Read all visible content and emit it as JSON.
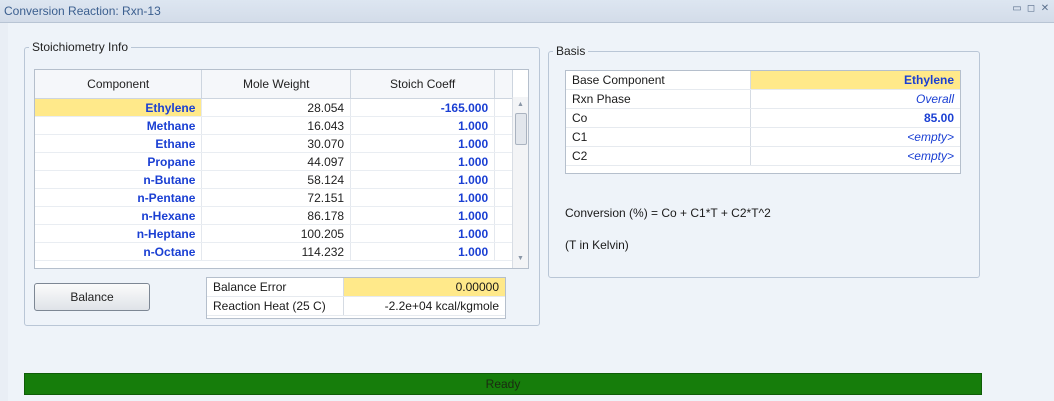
{
  "window": {
    "title": "Conversion Reaction: Rxn-13"
  },
  "stoich": {
    "legend": "Stoichiometry Info",
    "headers": [
      "Component",
      "Mole Weight",
      "Stoich Coeff"
    ],
    "rows": [
      {
        "component": "Ethylene",
        "mw": "28.054",
        "coeff": "-165.000"
      },
      {
        "component": "Methane",
        "mw": "16.043",
        "coeff": "1.000"
      },
      {
        "component": "Ethane",
        "mw": "30.070",
        "coeff": "1.000"
      },
      {
        "component": "Propane",
        "mw": "44.097",
        "coeff": "1.000"
      },
      {
        "component": "n-Butane",
        "mw": "58.124",
        "coeff": "1.000"
      },
      {
        "component": "n-Pentane",
        "mw": "72.151",
        "coeff": "1.000"
      },
      {
        "component": "n-Hexane",
        "mw": "86.178",
        "coeff": "1.000"
      },
      {
        "component": "n-Heptane",
        "mw": "100.205",
        "coeff": "1.000"
      },
      {
        "component": "n-Octane",
        "mw": "114.232",
        "coeff": "1.000"
      }
    ],
    "balance_button": "Balance",
    "balance_error_label": "Balance Error",
    "balance_error_value": "0.00000",
    "reaction_heat_label": "Reaction Heat (25 C)",
    "reaction_heat_value": "-2.2e+04 kcal/kgmole"
  },
  "basis": {
    "legend": "Basis",
    "rows": [
      {
        "label": "Base Component",
        "value": "Ethylene"
      },
      {
        "label": "Rxn Phase",
        "value": "Overall"
      },
      {
        "label": "Co",
        "value": "85.00"
      },
      {
        "label": "C1",
        "value": "<empty>"
      },
      {
        "label": "C2",
        "value": "<empty>"
      }
    ],
    "formula": "Conversion (%) = Co + C1*T + C2*T^2",
    "note": "(T in Kelvin)"
  },
  "status": {
    "text": "Ready"
  },
  "colors": {
    "status_bar": "#167d0b",
    "highlight": "#ffe98a",
    "value_blue": "#1a3fd3"
  }
}
